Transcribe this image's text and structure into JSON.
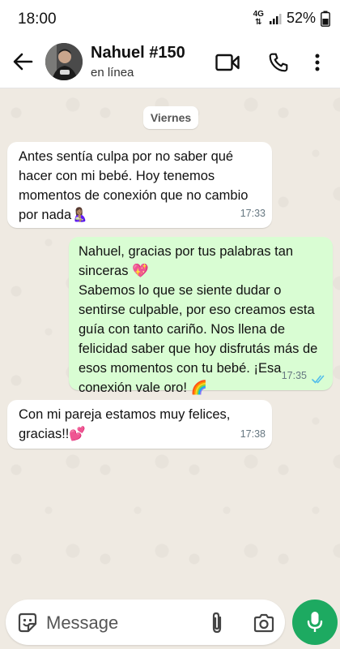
{
  "status_bar": {
    "time": "18:00",
    "network": "4G",
    "battery": "52%"
  },
  "header": {
    "name": "Nahuel #150",
    "status": "en línea"
  },
  "chat": {
    "date_label": "Viernes",
    "messages": [
      {
        "direction": "incoming",
        "text": "Antes sentía culpa por no saber qué\nhacer con mi bebé. Hoy tenemos\nmomentos de conexión que no cambio\npor nada🤱🏽",
        "time": "17:33"
      },
      {
        "direction": "outgoing",
        "text": "Nahuel, gracias por tus palabras tan\nsinceras 💖\nSabemos lo que se siente dudar o\nsentirse culpable, por eso creamos esta\nguía con tanto cariño. Nos llena de\nfelicidad saber que hoy disfrutás más de\nesos momentos con tu bebé. ¡Esa\nconexión vale oro! 🌈",
        "time": "17:35",
        "read": true
      },
      {
        "direction": "incoming",
        "text": "Con mi pareja estamos muy felices,\ngracias!!💕",
        "time": "17:38"
      }
    ]
  },
  "composer": {
    "placeholder": "Message"
  },
  "colors": {
    "outgoing_bubble": "#d9fdd3",
    "incoming_bubble": "#ffffff",
    "accent": "#1daa61",
    "read_ticks": "#53bdeb"
  }
}
